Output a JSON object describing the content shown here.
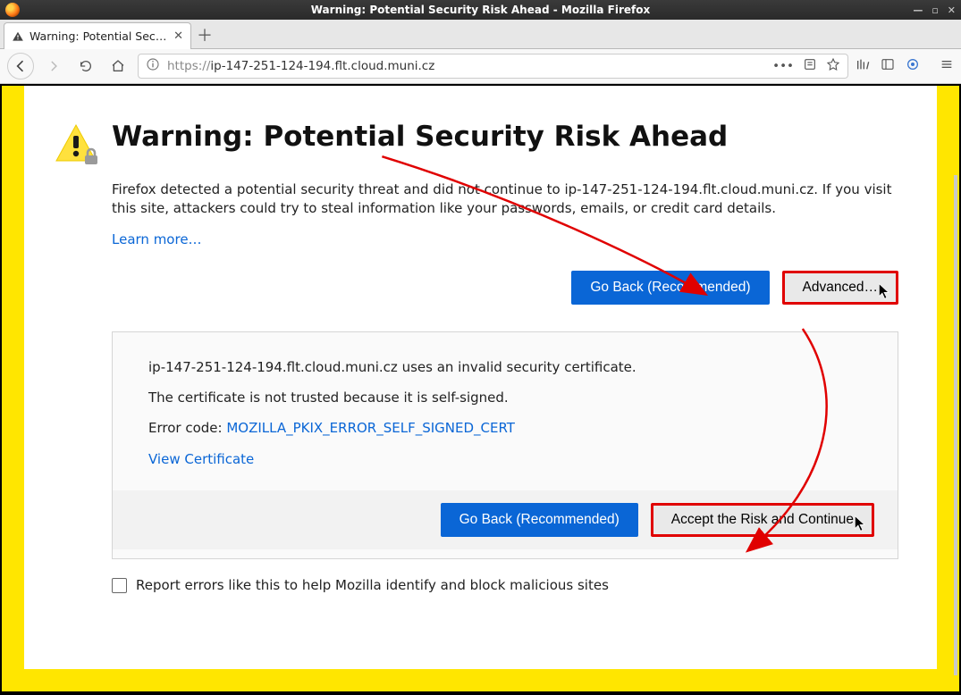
{
  "window": {
    "title": "Warning: Potential Security Risk Ahead - Mozilla Firefox"
  },
  "tab": {
    "label": "Warning: Potential Securi"
  },
  "url": {
    "protocol": "https://",
    "host_path": "ip-147-251-124-194.flt.cloud.muni.cz"
  },
  "page": {
    "heading": "Warning: Potential Security Risk Ahead",
    "paragraph": "Firefox detected a potential security threat and did not continue to ip-147-251-124-194.flt.cloud.muni.cz. If you visit this site, attackers could try to steal information like your passwords, emails, or credit card details.",
    "learn_more": "Learn more…",
    "btn_go_back": "Go Back (Recommended)",
    "btn_advanced": "Advanced…",
    "advanced": {
      "line1": "ip-147-251-124-194.flt.cloud.muni.cz uses an invalid security certificate.",
      "line2": "The certificate is not trusted because it is self-signed.",
      "error_label": "Error code: ",
      "error_code": "MOZILLA_PKIX_ERROR_SELF_SIGNED_CERT",
      "view_cert": "View Certificate",
      "btn_go_back": "Go Back (Recommended)",
      "btn_accept": "Accept the Risk and Continue"
    },
    "report_label": "Report errors like this to help Mozilla identify and block malicious sites"
  }
}
